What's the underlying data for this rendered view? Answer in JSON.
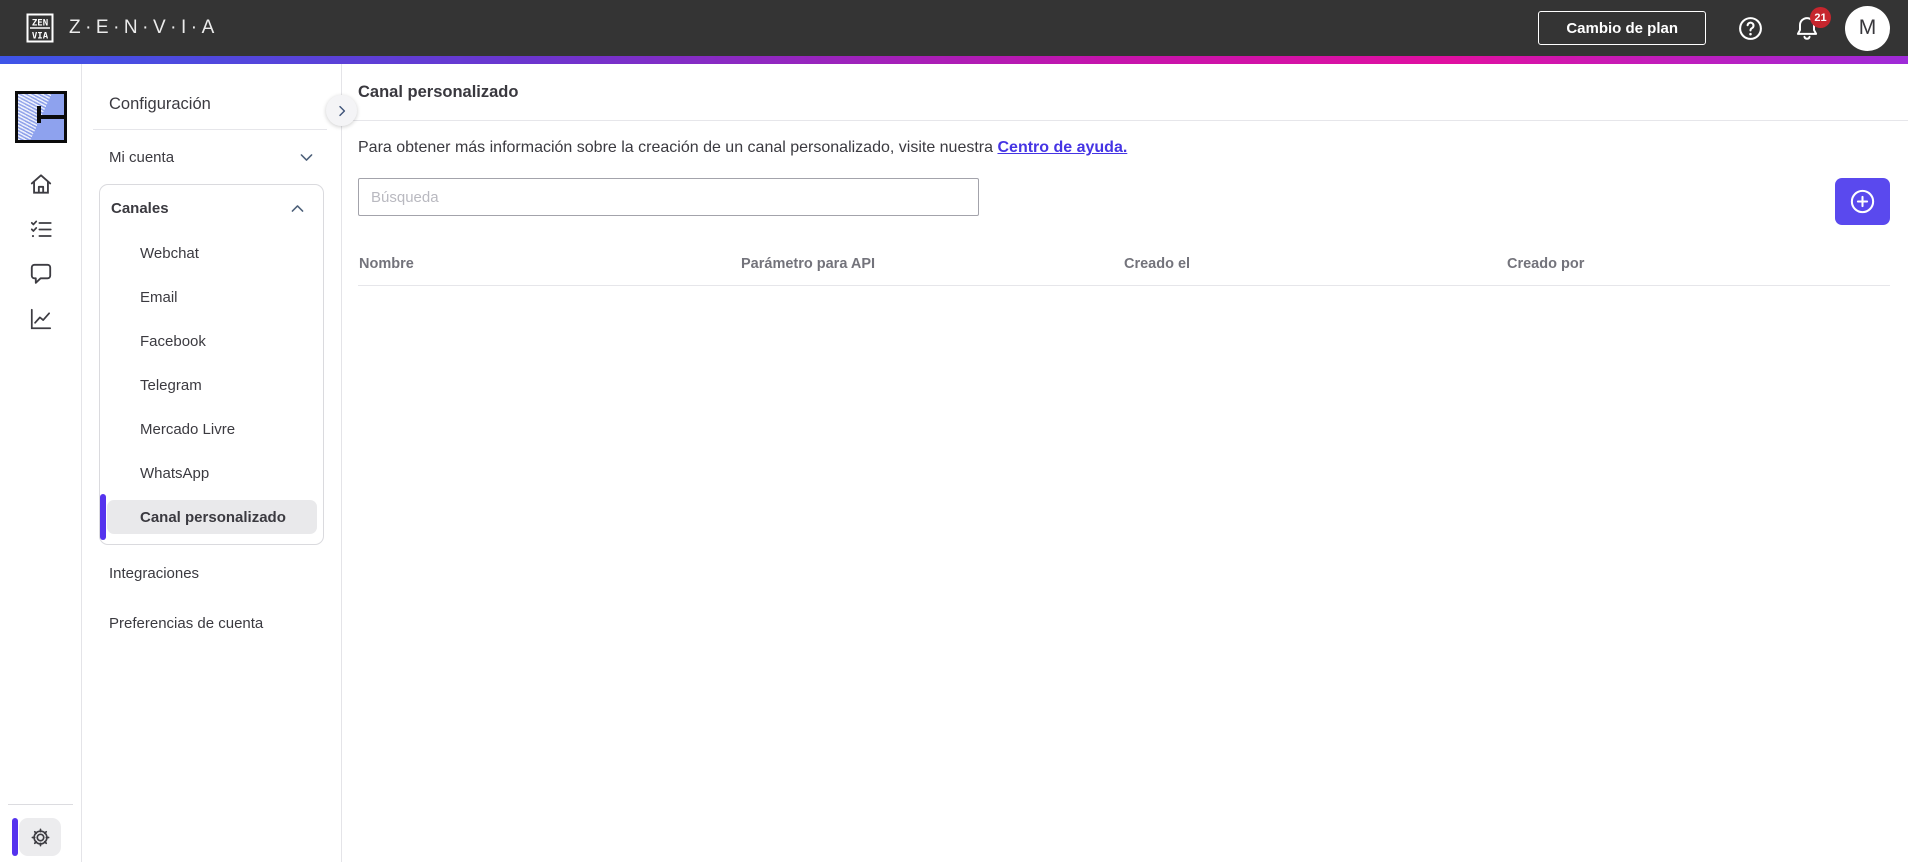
{
  "topbar": {
    "brand_text": "Z·E·N·V·I·A",
    "logo_top": "ZEN",
    "logo_bottom": "VIA",
    "change_plan_label": "Cambio de plan",
    "notification_count": "21",
    "avatar_initial": "M"
  },
  "sidebar": {
    "title": "Configuración",
    "my_account_label": "Mi cuenta",
    "channels": {
      "label": "Canales",
      "items": [
        "Webchat",
        "Email",
        "Facebook",
        "Telegram",
        "Mercado Livre",
        "WhatsApp",
        "Canal personalizado"
      ],
      "selected": "Canal personalizado"
    },
    "integrations_label": "Integraciones",
    "preferences_label": "Preferencias de cuenta"
  },
  "main": {
    "title": "Canal personalizado",
    "intro_text": "Para obtener más información sobre la creación de un canal personalizado, visite nuestra",
    "intro_link_label": "Centro de ayuda.",
    "search": {
      "placeholder": "Búsqueda",
      "value": ""
    },
    "table": {
      "columns": [
        "Nombre",
        "Parámetro para API",
        "Creado el",
        "Creado por"
      ],
      "rows": []
    }
  },
  "icons": {
    "rail": [
      "home-icon",
      "checklist-icon",
      "chat-icon",
      "chart-icon",
      "gear-icon"
    ],
    "topbar": [
      "help-icon",
      "bell-icon"
    ],
    "misc": [
      "chevron-right-icon",
      "chevron-down-icon",
      "chevron-up-icon",
      "plus-circle-icon"
    ]
  },
  "colors": {
    "topbar_bg": "#343434",
    "gradient": [
      "#3E55E8",
      "#6C35CE",
      "#C514AC",
      "#E010A0",
      "#9E2BD8"
    ],
    "accent_button": "#5A49EE",
    "selected_bar": "#5533EE",
    "link": "#4534E4",
    "badge": "#C6262E",
    "selected_pill": "#e9e9eb"
  }
}
